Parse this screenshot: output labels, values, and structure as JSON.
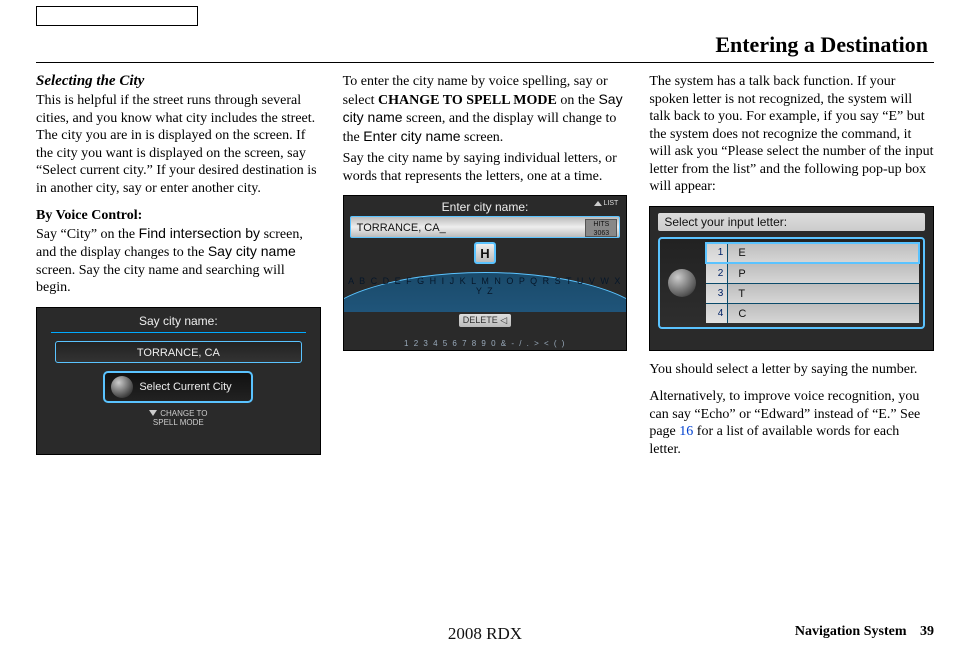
{
  "header": {
    "page_title": "Entering a Destination"
  },
  "col1": {
    "subhead": "Selecting the City",
    "p1": "This is helpful if the street runs through several cities, and you know what city includes the street. The city you are in is displayed on the screen. If the city you want is displayed on the screen, say “Select current city.” If your desired destination is in another city, say or enter another city.",
    "by_voice_label": "By Voice Control:",
    "p2a": "Say “City” on the ",
    "p2b": "Find intersection by",
    "p2c": " screen, and the display changes to the ",
    "p2d": "Say city name",
    "p2e": " screen. Say the city name and searching will begin.",
    "fig1": {
      "header": "Say city name:",
      "field_value": "TORRANCE, CA",
      "button_label": "Select Current City",
      "bottom_line1": "CHANGE TO",
      "bottom_line2": "SPELL MODE"
    }
  },
  "col2": {
    "p1a": "To enter the city name by voice spelling, say or select ",
    "p1b": "CHANGE TO SPELL MODE",
    "p1c": " on the ",
    "p1d": "Say city name",
    "p1e": " screen, and the display will change to the ",
    "p1f": "Enter city name",
    "p1g": " screen.",
    "p2": "Say the city name by saying individual letters, or words that represents the letters, one at a time.",
    "fig2": {
      "header": "Enter city name:",
      "list_label": "LIST",
      "input_value": "TORRANCE, CA_",
      "hits_label": "HITS",
      "hits_value": "3063",
      "highlight_letter": "H",
      "arc_letters": "A B C D E F G H I J K L M N O P Q R S T U V W X Y Z",
      "delete_label": "DELETE",
      "num_row": "1 2 3 4 5 6 7 8 9 0 & - / . > < ( )"
    }
  },
  "col3": {
    "p1": "The system has a talk back function. If your spoken letter is not recognized, the system will talk back to you. For example, if you say “E” but the system does not recognize the command, it will ask you “Please select the number of the input letter from the list” and the following pop-up box will appear:",
    "fig3": {
      "header": "Select your input letter:",
      "rows": [
        {
          "num": "1",
          "letter": "E"
        },
        {
          "num": "2",
          "letter": "P"
        },
        {
          "num": "3",
          "letter": "T"
        },
        {
          "num": "4",
          "letter": "C"
        }
      ]
    },
    "p2": "You should select a letter by saying the number.",
    "p3a": "Alternatively, to improve voice recognition, you can say “Echo” or “Edward” instead of “E.” See page ",
    "p3b": "16",
    "p3c": " for a list of available words for each letter."
  },
  "footer": {
    "center": "2008 RDX",
    "system_label": "Navigation System",
    "page_number": "39"
  }
}
